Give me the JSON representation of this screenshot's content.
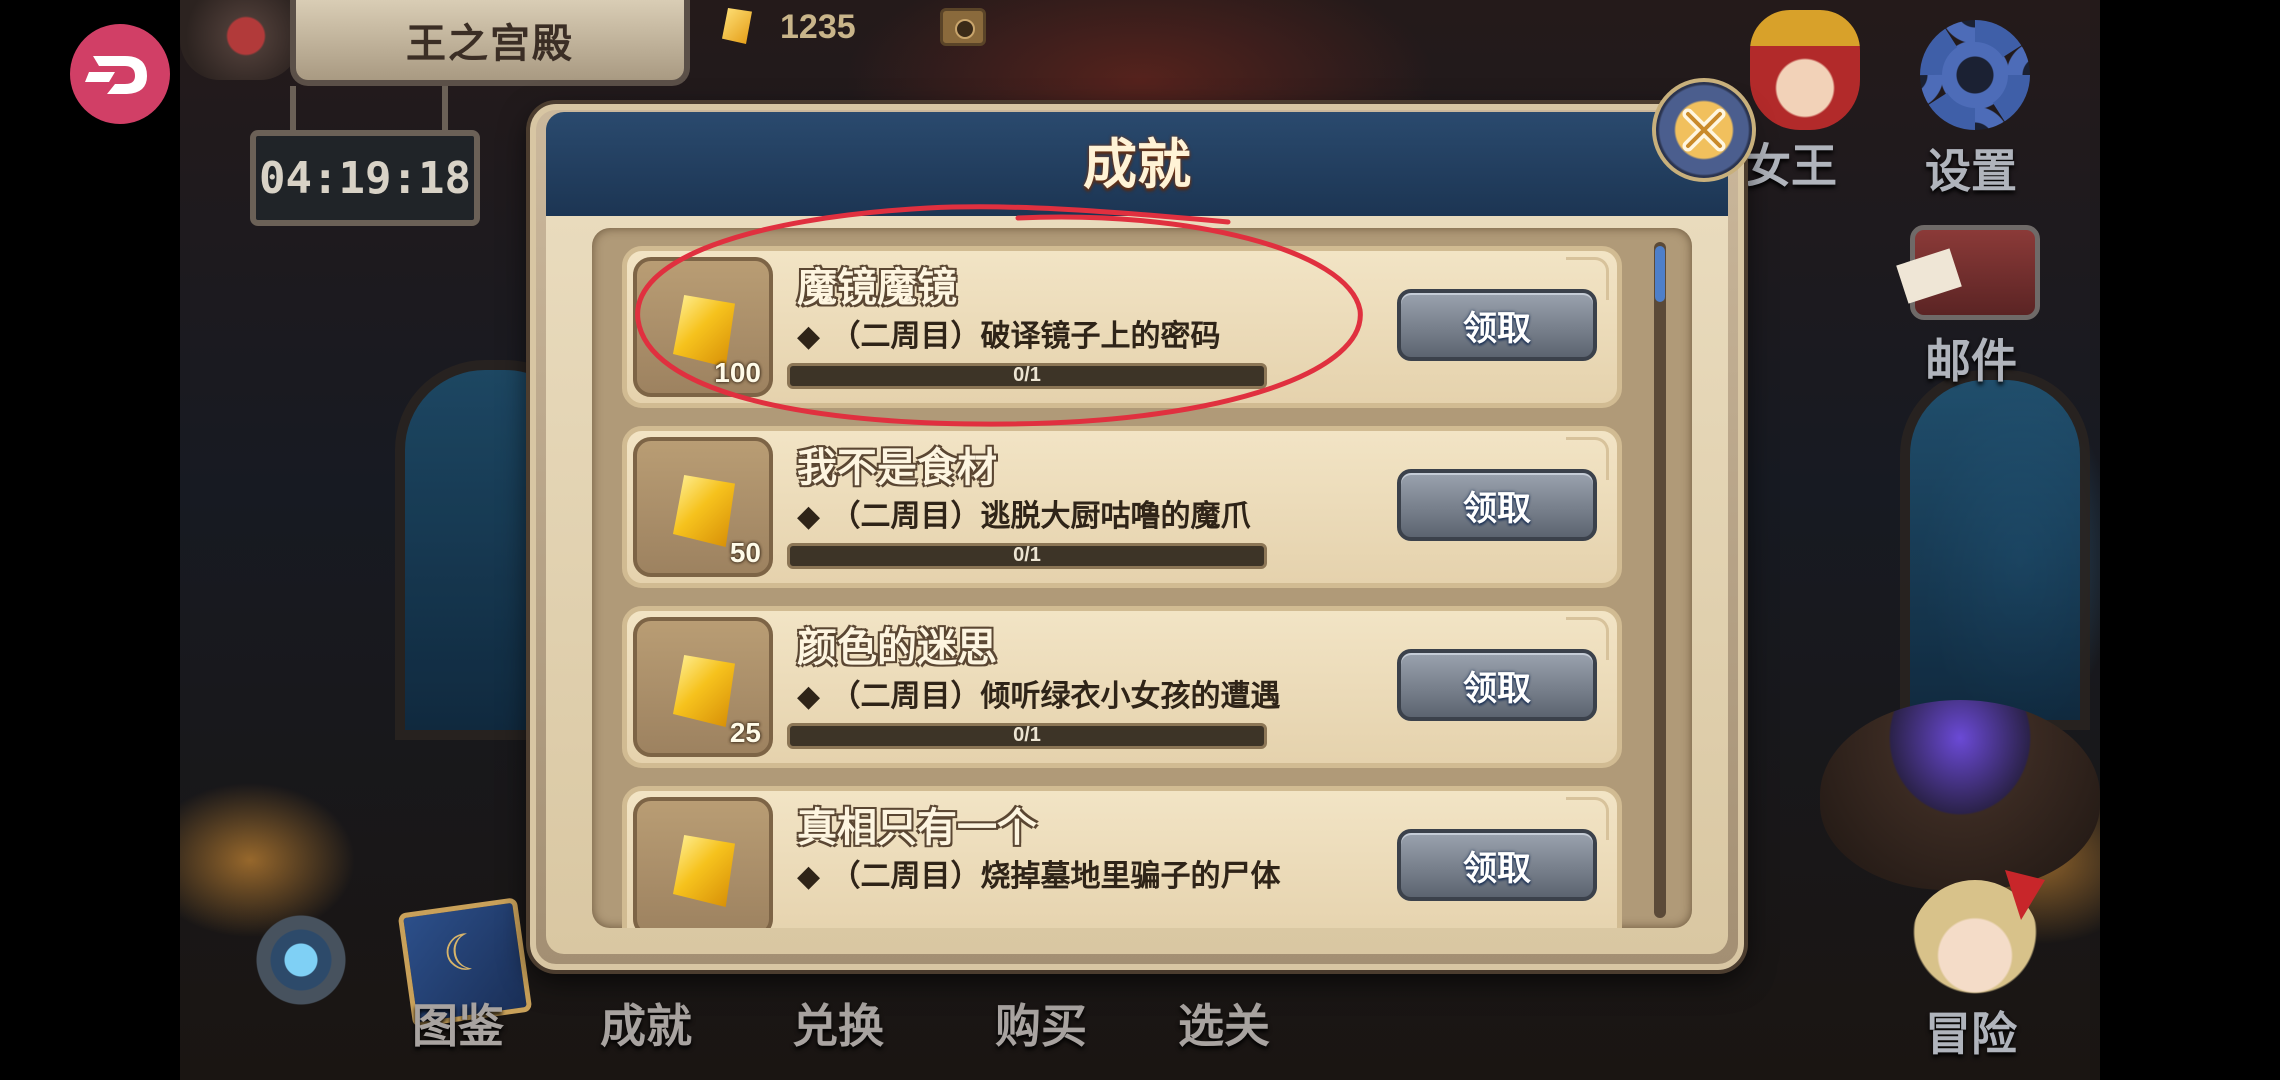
{
  "hud": {
    "location": "王之宫殿",
    "timer": "04:19:18",
    "gems": "1235"
  },
  "side_nav": {
    "queen": "女王",
    "settings": "设置",
    "mail": "邮件",
    "adventure": "冒险"
  },
  "bottom_nav": {
    "collection": "图鉴",
    "achievements": "成就",
    "exchange": "兑换",
    "purchase": "购买",
    "stage_select": "选关"
  },
  "dialog": {
    "title": "成就",
    "achievements": [
      {
        "title": "魔镜魔镜",
        "desc": "◆ （二周目）破译镜子上的密码",
        "reward": "100",
        "progress": "0/1",
        "progress_value": 0,
        "button": "领取"
      },
      {
        "title": "我不是食材",
        "desc": "◆ （二周目）逃脱大厨咕噜的魔爪",
        "reward": "50",
        "progress": "0/1",
        "progress_value": 0,
        "button": "领取"
      },
      {
        "title": "颜色的迷思",
        "desc": "◆ （二周目）倾听绿衣小女孩的遭遇",
        "reward": "25",
        "progress": "0/1",
        "progress_value": 0,
        "button": "领取"
      },
      {
        "title": "真相只有一个",
        "desc": "◆ （二周目）烧掉墓地里骗子的尸体",
        "reward": "",
        "progress": "",
        "progress_value": 0,
        "button": "领取"
      }
    ]
  },
  "colors": {
    "dialog_header": "#1c3553",
    "annotation": "#e0303f",
    "crystal": "#f6c21d"
  },
  "icons": [
    "app-logo-icon",
    "emblem-icon",
    "gem-icon",
    "camera-icon",
    "queen-icon",
    "gear-icon",
    "mail-icon",
    "girl-avatar-icon",
    "compass-icon",
    "book-icon",
    "crystal-icon",
    "close-icon"
  ]
}
